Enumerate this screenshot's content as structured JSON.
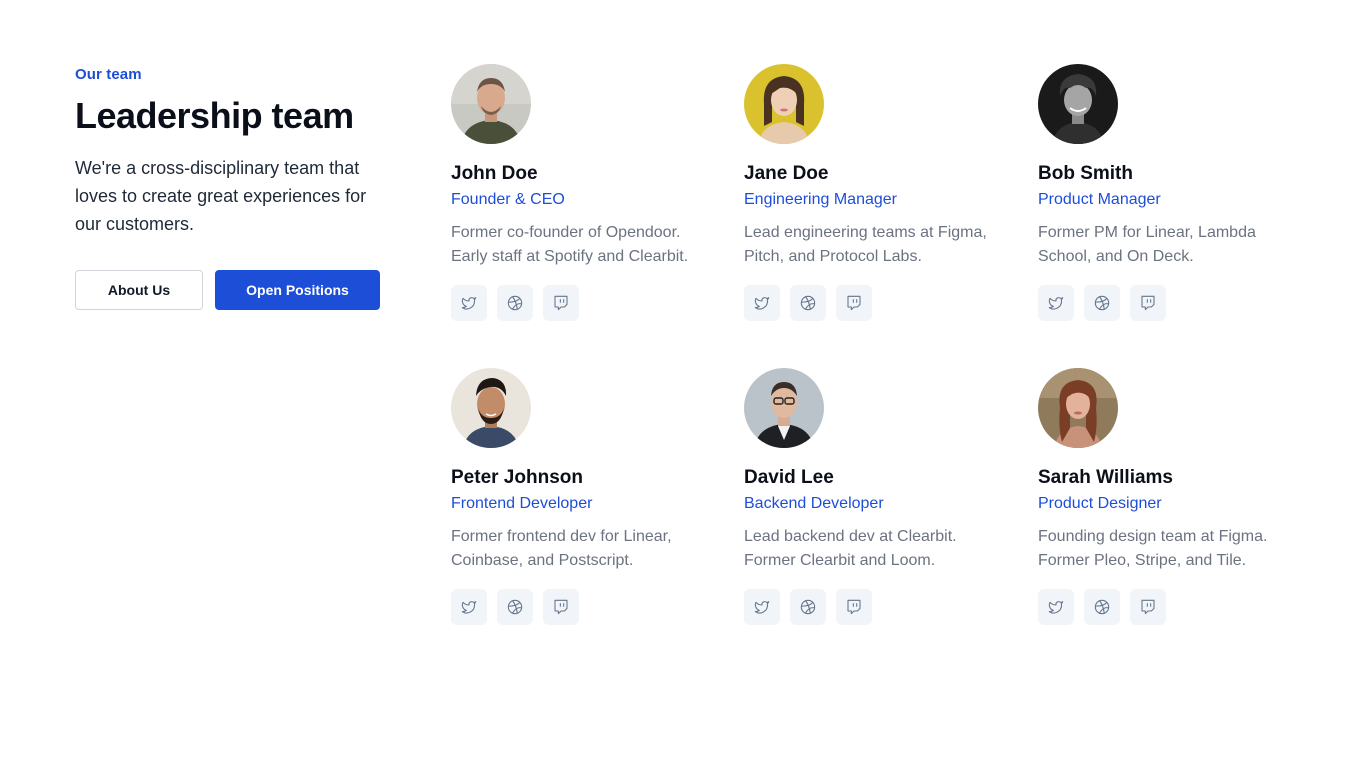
{
  "intro": {
    "eyebrow": "Our team",
    "headline": "Leadership team",
    "lead": "We're a cross-disciplinary team that loves to create great experiences for our customers.",
    "about_label": "About Us",
    "positions_label": "Open Positions"
  },
  "colors": {
    "accent": "#1d4ed8",
    "muted": "#6b7280",
    "icon_bg": "#f1f5f9"
  },
  "team": [
    {
      "name": "John Doe",
      "role": "Founder & CEO",
      "bio": "Former co-founder of Opendoor. Early staff at Spotify and Clearbit."
    },
    {
      "name": "Jane Doe",
      "role": "Engineering Manager",
      "bio": "Lead engineering teams at Figma, Pitch, and Protocol Labs."
    },
    {
      "name": "Bob Smith",
      "role": "Product Manager",
      "bio": "Former PM for Linear, Lambda School, and On Deck."
    },
    {
      "name": "Peter Johnson",
      "role": "Frontend Developer",
      "bio": "Former frontend dev for Linear, Coinbase, and Postscript."
    },
    {
      "name": "David Lee",
      "role": "Backend Developer",
      "bio": "Lead backend dev at Clearbit. Former Clearbit and Loom."
    },
    {
      "name": "Sarah Williams",
      "role": "Product Designer",
      "bio": "Founding design team at Figma. Former Pleo, Stripe, and Tile."
    }
  ],
  "social_icons": [
    "twitter-icon",
    "dribbble-icon",
    "twitch-icon"
  ]
}
